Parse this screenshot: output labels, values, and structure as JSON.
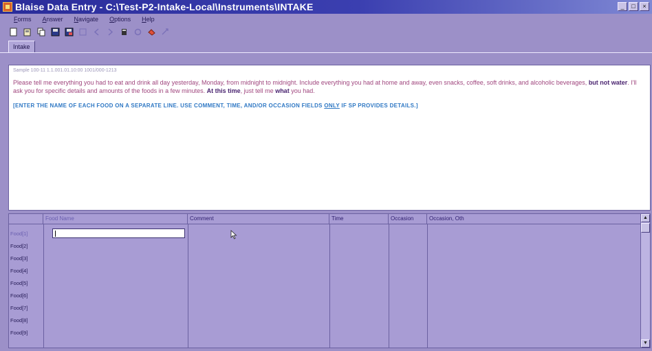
{
  "window": {
    "title": "Blaise Data Entry - C:\\Test-P2-Intake-Local\\Instruments\\INTAKE",
    "minimize": "_",
    "maximize": "□",
    "close": "×"
  },
  "menu": [
    "Forms",
    "Answer",
    "Navigate",
    "Options",
    "Help"
  ],
  "toolbar": {
    "icons": [
      "new-form-icon",
      "open-form-icon",
      "copy-icon",
      "save-icon",
      "save-as-icon",
      "first-page-icon",
      "previous-icon",
      "next-icon",
      "last-icon",
      "lookup-icon",
      "watch-window-icon",
      "remarks-icon"
    ]
  },
  "tabs": {
    "intake": "Intake"
  },
  "question": {
    "header": "Sample 100-11   1.1.001.01.10:00   1001/000-1213",
    "line1": "Please tell me everything you had to eat and drink all day yesterday, Monday, from midnight to midnight. Include everything you had at home and away, even snacks, coffee, soft drinks, and alcoholic beverages, ",
    "line1_bold": "but not water",
    "line2": ". I'll ask you for specific details and amounts of the foods in a few minutes. ",
    "line2_bold": "At this time",
    "line3": ", just tell me ",
    "line3_bold": "what",
    "line4": " you had.",
    "instr_a": "[ENTER THE NAME OF EACH FOOD ON A SEPARATE LINE.  USE COMMENT, TIME, AND/OR OCCASION FIELDS ",
    "instr_only": "ONLY",
    "instr_b": " IF SP PROVIDES DETAILS.]"
  },
  "grid": {
    "headers": [
      "Food Name",
      "Comment",
      "Time",
      "Occasion",
      "Occasion, Oth"
    ],
    "rows": [
      "Food[1]",
      "Food[2]",
      "Food[3]",
      "Food[4]",
      "Food[5]",
      "Food[6]",
      "Food[7]",
      "Food[8]",
      "Food[9]"
    ],
    "food_value": ""
  },
  "colors": {
    "background": "#9c90c8",
    "question_text": "#a0467e",
    "instruction_text": "#2f78c4",
    "titlebar": "#2a2c9a"
  }
}
